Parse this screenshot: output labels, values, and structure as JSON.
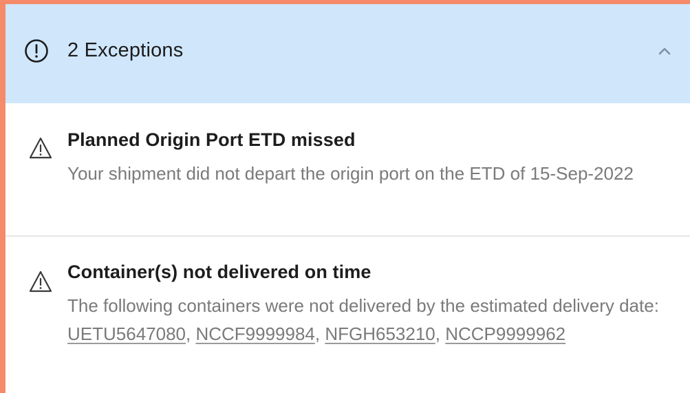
{
  "exceptions_panel": {
    "header_title": "2 Exceptions",
    "items": [
      {
        "title": "Planned Origin Port ETD missed",
        "description": "Your shipment did not depart the origin port on the ETD of 15-Sep-2022"
      },
      {
        "title": "Container(s) not delivered on time",
        "description_prefix": "The following containers were not delivered by the estimated delivery date: ",
        "containers": [
          "UETU5647080",
          "NCCF9999984",
          "NFGH653210",
          "NCCP9999962"
        ],
        "separator": ", "
      }
    ]
  }
}
